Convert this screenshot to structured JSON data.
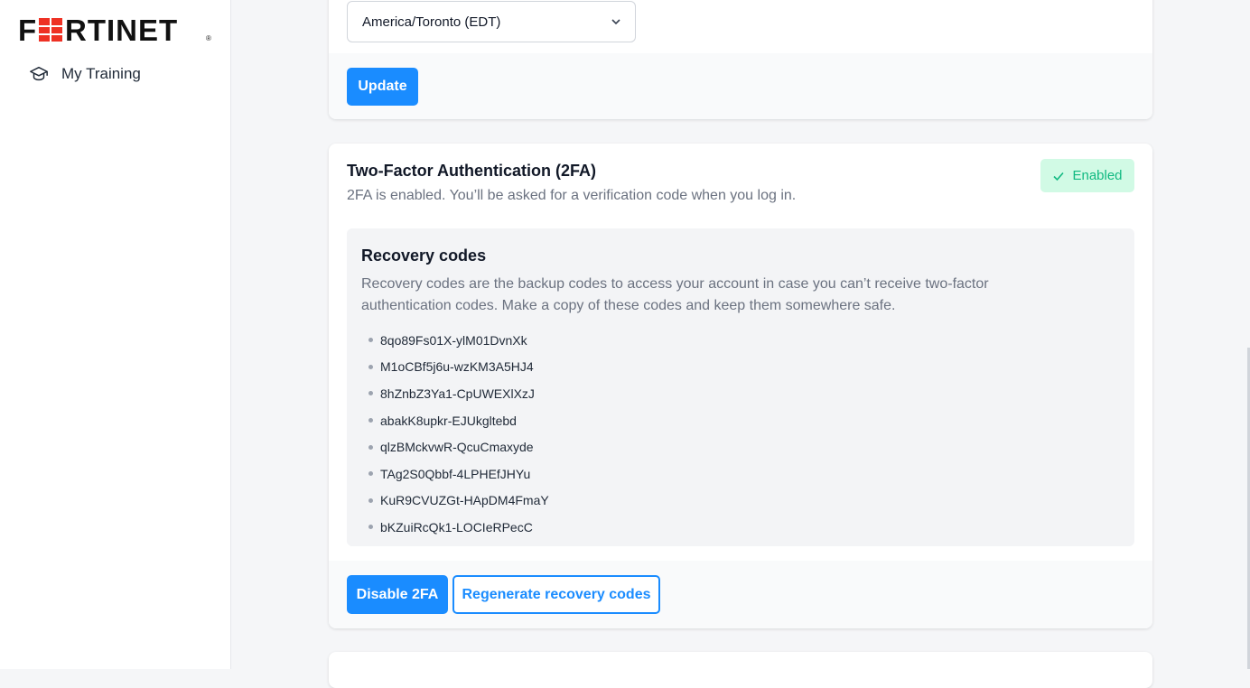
{
  "brand": {
    "logo_text": "FORTINET",
    "accent": "#1a8cff",
    "logo_color": "#ee3124"
  },
  "sidebar": {
    "items": [
      {
        "label": "My Training",
        "icon": "graduation-cap-icon"
      }
    ]
  },
  "timezone": {
    "selected": "America/Toronto (EDT)",
    "update_label": "Update"
  },
  "twofa": {
    "title": "Two-Factor Authentication (2FA)",
    "description": "2FA is enabled. You’ll be asked for a verification code when you log in.",
    "status": "Enabled",
    "status_color": "#10b981",
    "recovery": {
      "title": "Recovery codes",
      "description": "Recovery codes are the backup codes to access your account in case you can’t receive two-factor authentication codes. Make a copy of these codes and keep them somewhere safe.",
      "codes": [
        "8qo89Fs01X-ylM01DvnXk",
        "M1oCBf5j6u-wzKM3A5HJ4",
        "8hZnbZ3Ya1-CpUWEXlXzJ",
        "abakK8upkr-EJUkgltebd",
        "qlzBMckvwR-QcuCmaxyde",
        "TAg2S0Qbbf-4LPHEfJHYu",
        "KuR9CVUZGt-HApDM4FmaY",
        "bKZuiRcQk1-LOCIeRPecC"
      ]
    },
    "disable_label": "Disable 2FA",
    "regenerate_label": "Regenerate recovery codes"
  }
}
